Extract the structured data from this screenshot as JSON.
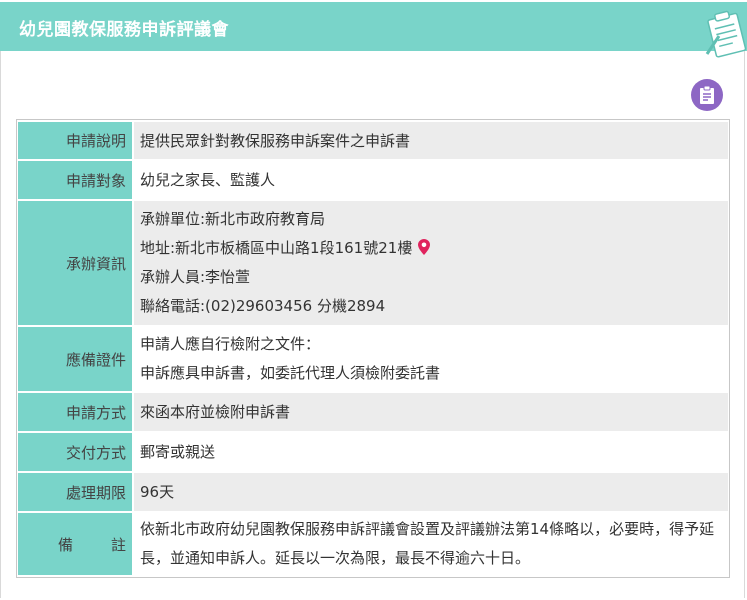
{
  "header": {
    "title": "幼兒園教保服務申訴評議會"
  },
  "toolbar": {
    "print_icon": "print-icon"
  },
  "rows": [
    {
      "label": "申請說明",
      "lines": [
        "提供民眾針對教保服務申訴案件之申訴書"
      ]
    },
    {
      "label": "申請對象",
      "lines": [
        "幼兒之家長、監護人"
      ]
    },
    {
      "label": "承辦資訊",
      "lines": [
        "承辦單位:新北市政府教育局",
        "地址:新北市板橋區中山路1段161號21樓",
        "承辦人員:李怡萱",
        "聯絡電話:(02)29603456 分機2894"
      ]
    },
    {
      "label": "應備證件",
      "lines": [
        "申請人應自行檢附之文件：",
        "申訴應具申訴書，如委託代理人須檢附委託書"
      ]
    },
    {
      "label": "申請方式",
      "lines": [
        "來函本府並檢附申訴書"
      ]
    },
    {
      "label": "交付方式",
      "lines": [
        "郵寄或親送"
      ]
    },
    {
      "label": "處理期限",
      "lines": [
        "96天"
      ]
    },
    {
      "label_a": "備",
      "label_b": "註",
      "lines": [
        "依新北市政府幼兒園教保服務申訴評議會設置及評議辦法第14條略以，必要時，得予延長，並通知申訴人。延長以一次為限，最長不得逾六十日。"
      ]
    }
  ],
  "colors": {
    "header_bg": "#79d4c9",
    "label_bg": "#79d4c9",
    "print_bg": "#8d67c4",
    "pin": "#e0245e"
  }
}
